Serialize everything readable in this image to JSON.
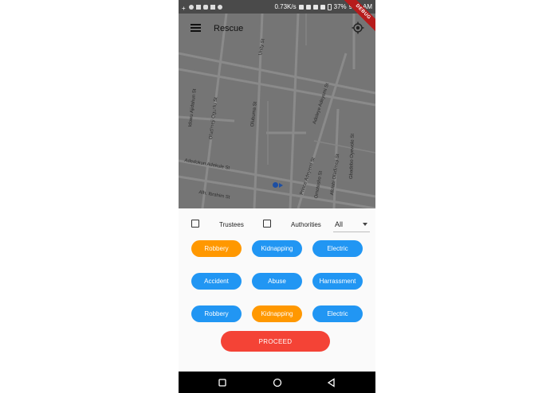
{
  "status_bar": {
    "speed": "0.73K/s",
    "battery": "37%",
    "time": "9:26 AM"
  },
  "app_bar": {
    "title": "Rescue",
    "debug_label": "DEBUG",
    "menu_icon": "menu-icon",
    "locate_icon": "my-location-icon"
  },
  "map": {
    "streets": [
      "Unity St",
      "Adeleye Adeyemi St",
      "Idowu Ajidahun St",
      "Oladimeji Ogunlu St",
      "Olubuma St",
      "Gbadebo Oyewole St",
      "Adedokun Adekule St",
      "Prince Adeyemi St",
      "Omotesho St",
      "Afolabi Oladimeji St",
      "Alh. Ibrahim St"
    ]
  },
  "filters": {
    "trustees_label": "Trustees",
    "authorities_label": "Authorities",
    "select_value": "All"
  },
  "categories": [
    {
      "label": "Robbery",
      "color": "orange"
    },
    {
      "label": "Kidnapping",
      "color": "blue"
    },
    {
      "label": "Electric",
      "color": "blue"
    },
    {
      "label": "Accident",
      "color": "blue"
    },
    {
      "label": "Abuse",
      "color": "blue"
    },
    {
      "label": "Harrassment",
      "color": "blue"
    },
    {
      "label": "Robbery",
      "color": "blue"
    },
    {
      "label": "Kidnapping",
      "color": "orange"
    },
    {
      "label": "Electric",
      "color": "blue"
    }
  ],
  "proceed_label": "PROCEED",
  "colors": {
    "chip_blue": "#2196f3",
    "chip_orange": "#ff9800",
    "proceed_red": "#f44336",
    "map_gray": "#757575"
  }
}
